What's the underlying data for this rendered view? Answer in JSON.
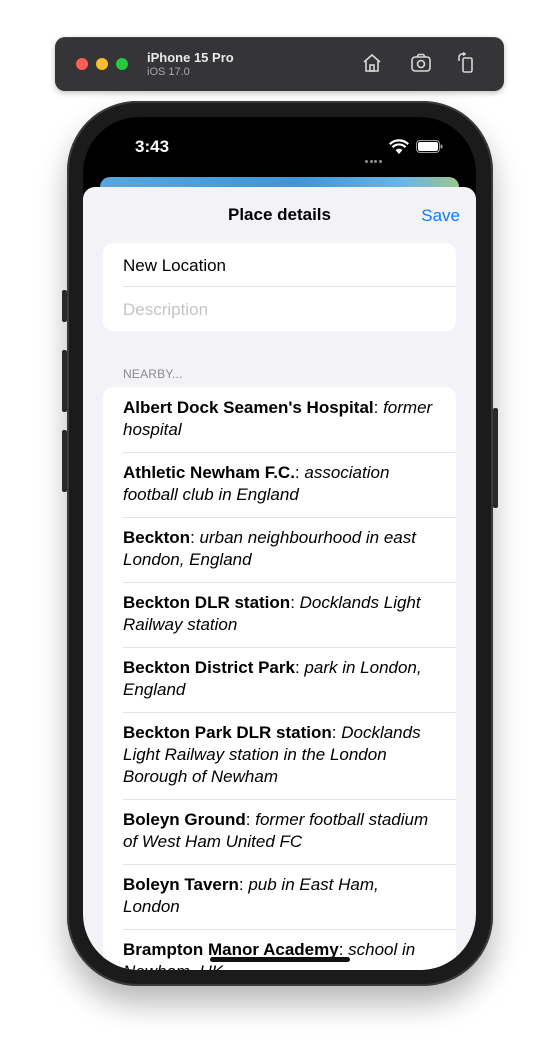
{
  "simulator": {
    "device_name": "iPhone 15 Pro",
    "os_version": "iOS 17.0",
    "icons": [
      "home-icon",
      "screenshot-icon",
      "rotate-icon"
    ]
  },
  "status_bar": {
    "time": "3:43"
  },
  "sheet": {
    "title": "Place details",
    "save_label": "Save",
    "name_value": "New Location",
    "description_placeholder": "Description",
    "nearby_header": "NEARBY...",
    "nearby": [
      {
        "name": "Albert Dock Seamen's Hospital",
        "description": "former hospital"
      },
      {
        "name": "Athletic Newham F.C.",
        "description": "association football club in England"
      },
      {
        "name": "Beckton",
        "description": "urban neighbourhood in east London, England"
      },
      {
        "name": "Beckton DLR station",
        "description": "Docklands Light Railway station"
      },
      {
        "name": "Beckton District Park",
        "description": "park in London, England"
      },
      {
        "name": "Beckton Park DLR station",
        "description": "Docklands Light Railway station in the London Borough of Newham"
      },
      {
        "name": "Boleyn Ground",
        "description": "former football stadium of West Ham United FC"
      },
      {
        "name": "Boleyn Tavern",
        "description": "pub in East Ham, London"
      },
      {
        "name": "Brampton Manor Academy",
        "description": "school in Newham, UK"
      }
    ]
  },
  "colors": {
    "accent": "#0a7aff",
    "background": "#f2f2f7"
  }
}
